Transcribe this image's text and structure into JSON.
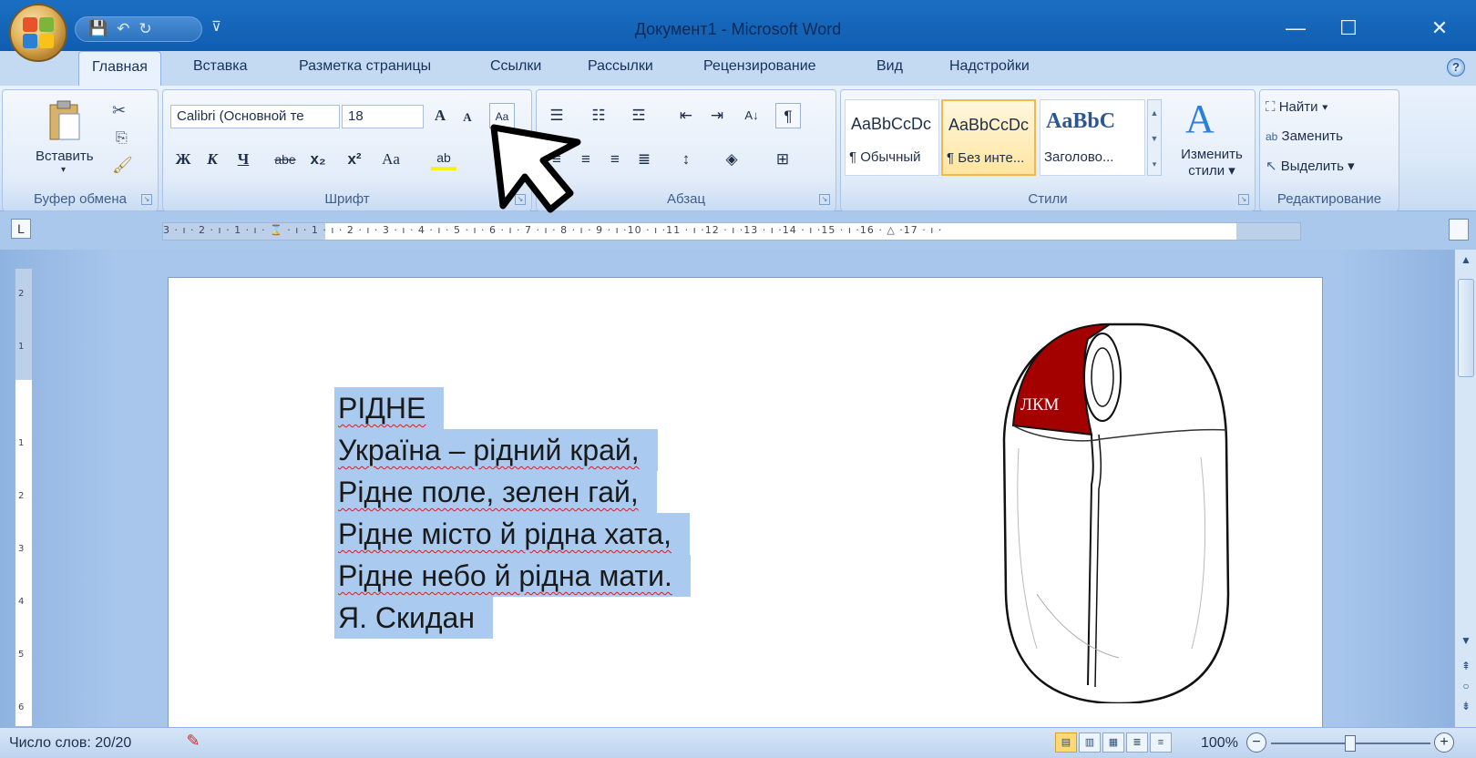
{
  "window": {
    "title": "Документ1 - Microsoft Word",
    "minimize": "—",
    "maximize": "☐",
    "close": "✕"
  },
  "qat": {
    "save": "💾",
    "undo": "↶",
    "redo": "↻",
    "customize": "⊽"
  },
  "tabs": [
    "Главная",
    "Вставка",
    "Разметка страницы",
    "Ссылки",
    "Рассылки",
    "Рецензирование",
    "Вид",
    "Надстройки"
  ],
  "ribbon": {
    "clipboard": {
      "paste_label": "Вставить",
      "group_label": "Буфер обмена"
    },
    "font": {
      "font_name": "Calibri (Основной те",
      "font_size": "18",
      "grow": "A",
      "shrink": "A",
      "bold": "Ж",
      "italic": "К",
      "underline": "Ч",
      "strike": "abe",
      "subscript": "x₂",
      "superscript": "x²",
      "case": "Aa",
      "group_label": "Шрифт"
    },
    "paragraph": {
      "group_label": "Абзац",
      "show_marks": "¶"
    },
    "styles": {
      "items": [
        {
          "sample": "AaBbCcDc",
          "name": "¶ Обычный"
        },
        {
          "sample": "AaBbCcDc",
          "name": "¶ Без инте..."
        },
        {
          "sample": "AaBbC",
          "name": "Заголово..."
        }
      ],
      "change_label_1": "Изменить",
      "change_label_2": "стили ▾",
      "group_label": "Стили"
    },
    "editing": {
      "find": "Найти ▾",
      "replace": "Заменить",
      "select": "Выделить ▾",
      "group_label": "Редактирование"
    }
  },
  "ruler": {
    "numbers": "3 · ı · 2 · ı · 1 · ı · ⌛ · ı · 1 · ı · 2 · ı · 3 · ı · 4 · ı · 5 · ı · 6 · ı · 7 · ı · 8 · ı · 9 · ı ·10 · ı ·11 · ı ·12 · ı ·13 · ı ·14 · ı ·15 · ı ·16 · △ ·17 · ı ·"
  },
  "document": {
    "lines": [
      "РІДНЕ",
      "Україна – рідний край,",
      "Рідне поле, зелен гай,",
      "Рідне місто й рідна хата,",
      "Рідне небо й рідна мати.",
      "Я. Скидан"
    ],
    "mouse_label": "ЛКМ"
  },
  "status": {
    "word_count": "Число слов: 20/20",
    "zoom": "100%"
  },
  "colors": {
    "selection": "#aacbef",
    "mouse_button": "#a30000",
    "ribbon": "#dbe8f8"
  }
}
